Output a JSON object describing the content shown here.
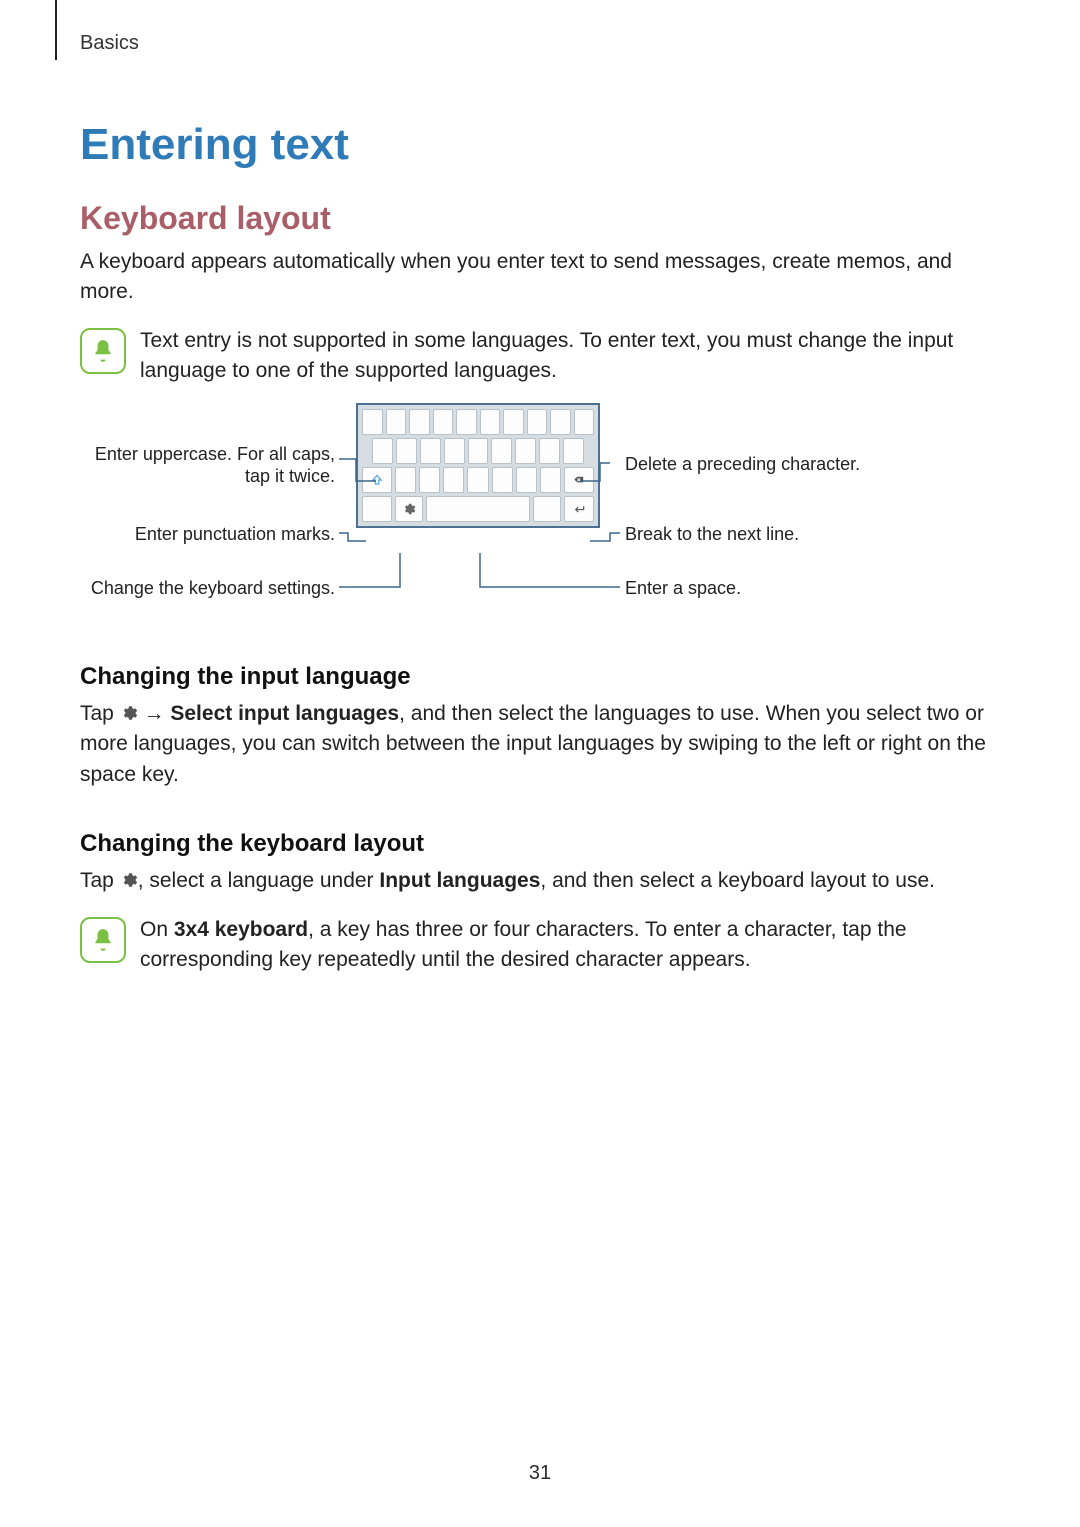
{
  "runhead": "Basics",
  "title": "Entering text",
  "section_keyboard": "Keyboard layout",
  "intro": "A keyboard appears automatically when you enter text to send messages, create memos, and more.",
  "note1": "Text entry is not supported in some languages. To enter text, you must change the input language to one of the supported languages.",
  "callouts": {
    "uppercase": "Enter uppercase. For all caps, tap it twice.",
    "punct": "Enter punctuation marks.",
    "settings": "Change the keyboard settings.",
    "delete": "Delete a preceding character.",
    "nextline": "Break to the next line.",
    "space": "Enter a space."
  },
  "sub_lang": "Changing the input language",
  "lang_p_before": "Tap ",
  "lang_p_arrow": " → ",
  "lang_p_bold": "Select input languages",
  "lang_p_after": ", and then select the languages to use. When you select two or more languages, you can switch between the input languages by swiping to the left or right on the space key.",
  "sub_layout": "Changing the keyboard layout",
  "layout_p_before": "Tap ",
  "layout_p_mid": ", select a language under ",
  "layout_p_bold": "Input languages",
  "layout_p_after": ", and then select a keyboard layout to use.",
  "note2_before": "On ",
  "note2_bold": "3x4 keyboard",
  "note2_after": ", a key has three or four characters. To enter a character, tap the corresponding key repeatedly until the desired character appears.",
  "page_number": "31"
}
